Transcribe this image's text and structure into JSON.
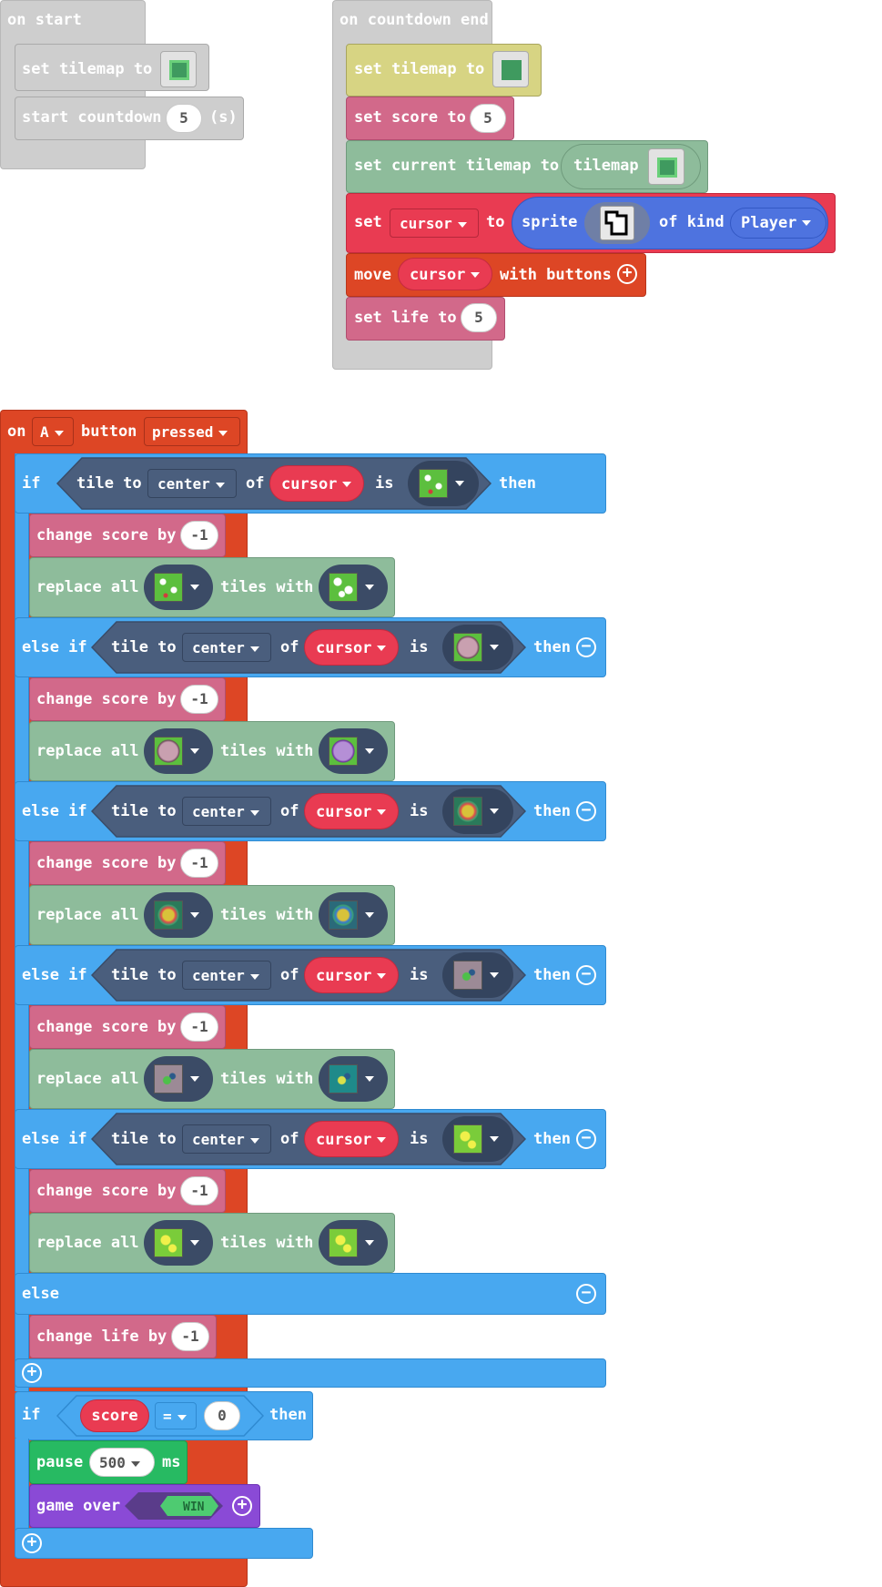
{
  "on_start": {
    "hat_label": "on start",
    "set_tilemap": "set tilemap to",
    "start_countdown": "start countdown",
    "countdown_value": "5",
    "seconds_unit": "(s)"
  },
  "on_countdown_end": {
    "hat_label": "on countdown end",
    "set_tilemap": "set tilemap to",
    "set_score": "set score to",
    "score_value": "5",
    "set_current_tilemap": "set current tilemap to",
    "tilemap_word": "tilemap",
    "set_word": "set",
    "cursor_var": "cursor",
    "to_word": "to",
    "sprite_word": "sprite",
    "of_kind": "of kind",
    "kind_value": "Player",
    "move_word": "move",
    "with_buttons": "with buttons",
    "set_life": "set life to",
    "life_value": "5"
  },
  "on_button": {
    "on_word": "on",
    "button_value": "A",
    "button_word": "button",
    "event_value": "pressed"
  },
  "keywords": {
    "if": "if",
    "else_if": "else if",
    "else": "else",
    "then": "then",
    "tile_to": "tile to",
    "center": "center",
    "of": "of",
    "cursor": "cursor",
    "is": "is",
    "change_score": "change score by",
    "replace_all": "replace all",
    "tiles_with": "tiles with",
    "change_life": "change life by",
    "minus_one": "-1"
  },
  "branches": [
    {
      "tile_from": "flowers",
      "tile_to": "flowers-white"
    },
    {
      "tile_from": "rock",
      "tile_to": "rock-purple"
    },
    {
      "tile_from": "bush",
      "tile_to": "bush-blue"
    },
    {
      "tile_from": "sprout-gray",
      "tile_to": "sprout-teal"
    },
    {
      "tile_from": "leaves-yellow",
      "tile_to": "leaves-yellow-2"
    }
  ],
  "score_check": {
    "if_word": "if",
    "score_var": "score",
    "operator": "=",
    "compare_value": "0",
    "then_word": "then",
    "pause_word": "pause",
    "pause_value": "500",
    "ms_unit": "ms",
    "game_over": "game over",
    "win_label": "WIN"
  },
  "colors": {
    "event_hat": "#dd4625",
    "logic": "#48a8f0",
    "scene": "#8ebc9b",
    "info": "#d2698a",
    "sprites": "#e93b52",
    "loops": "#27ba62",
    "game": "#8a4ad6"
  }
}
